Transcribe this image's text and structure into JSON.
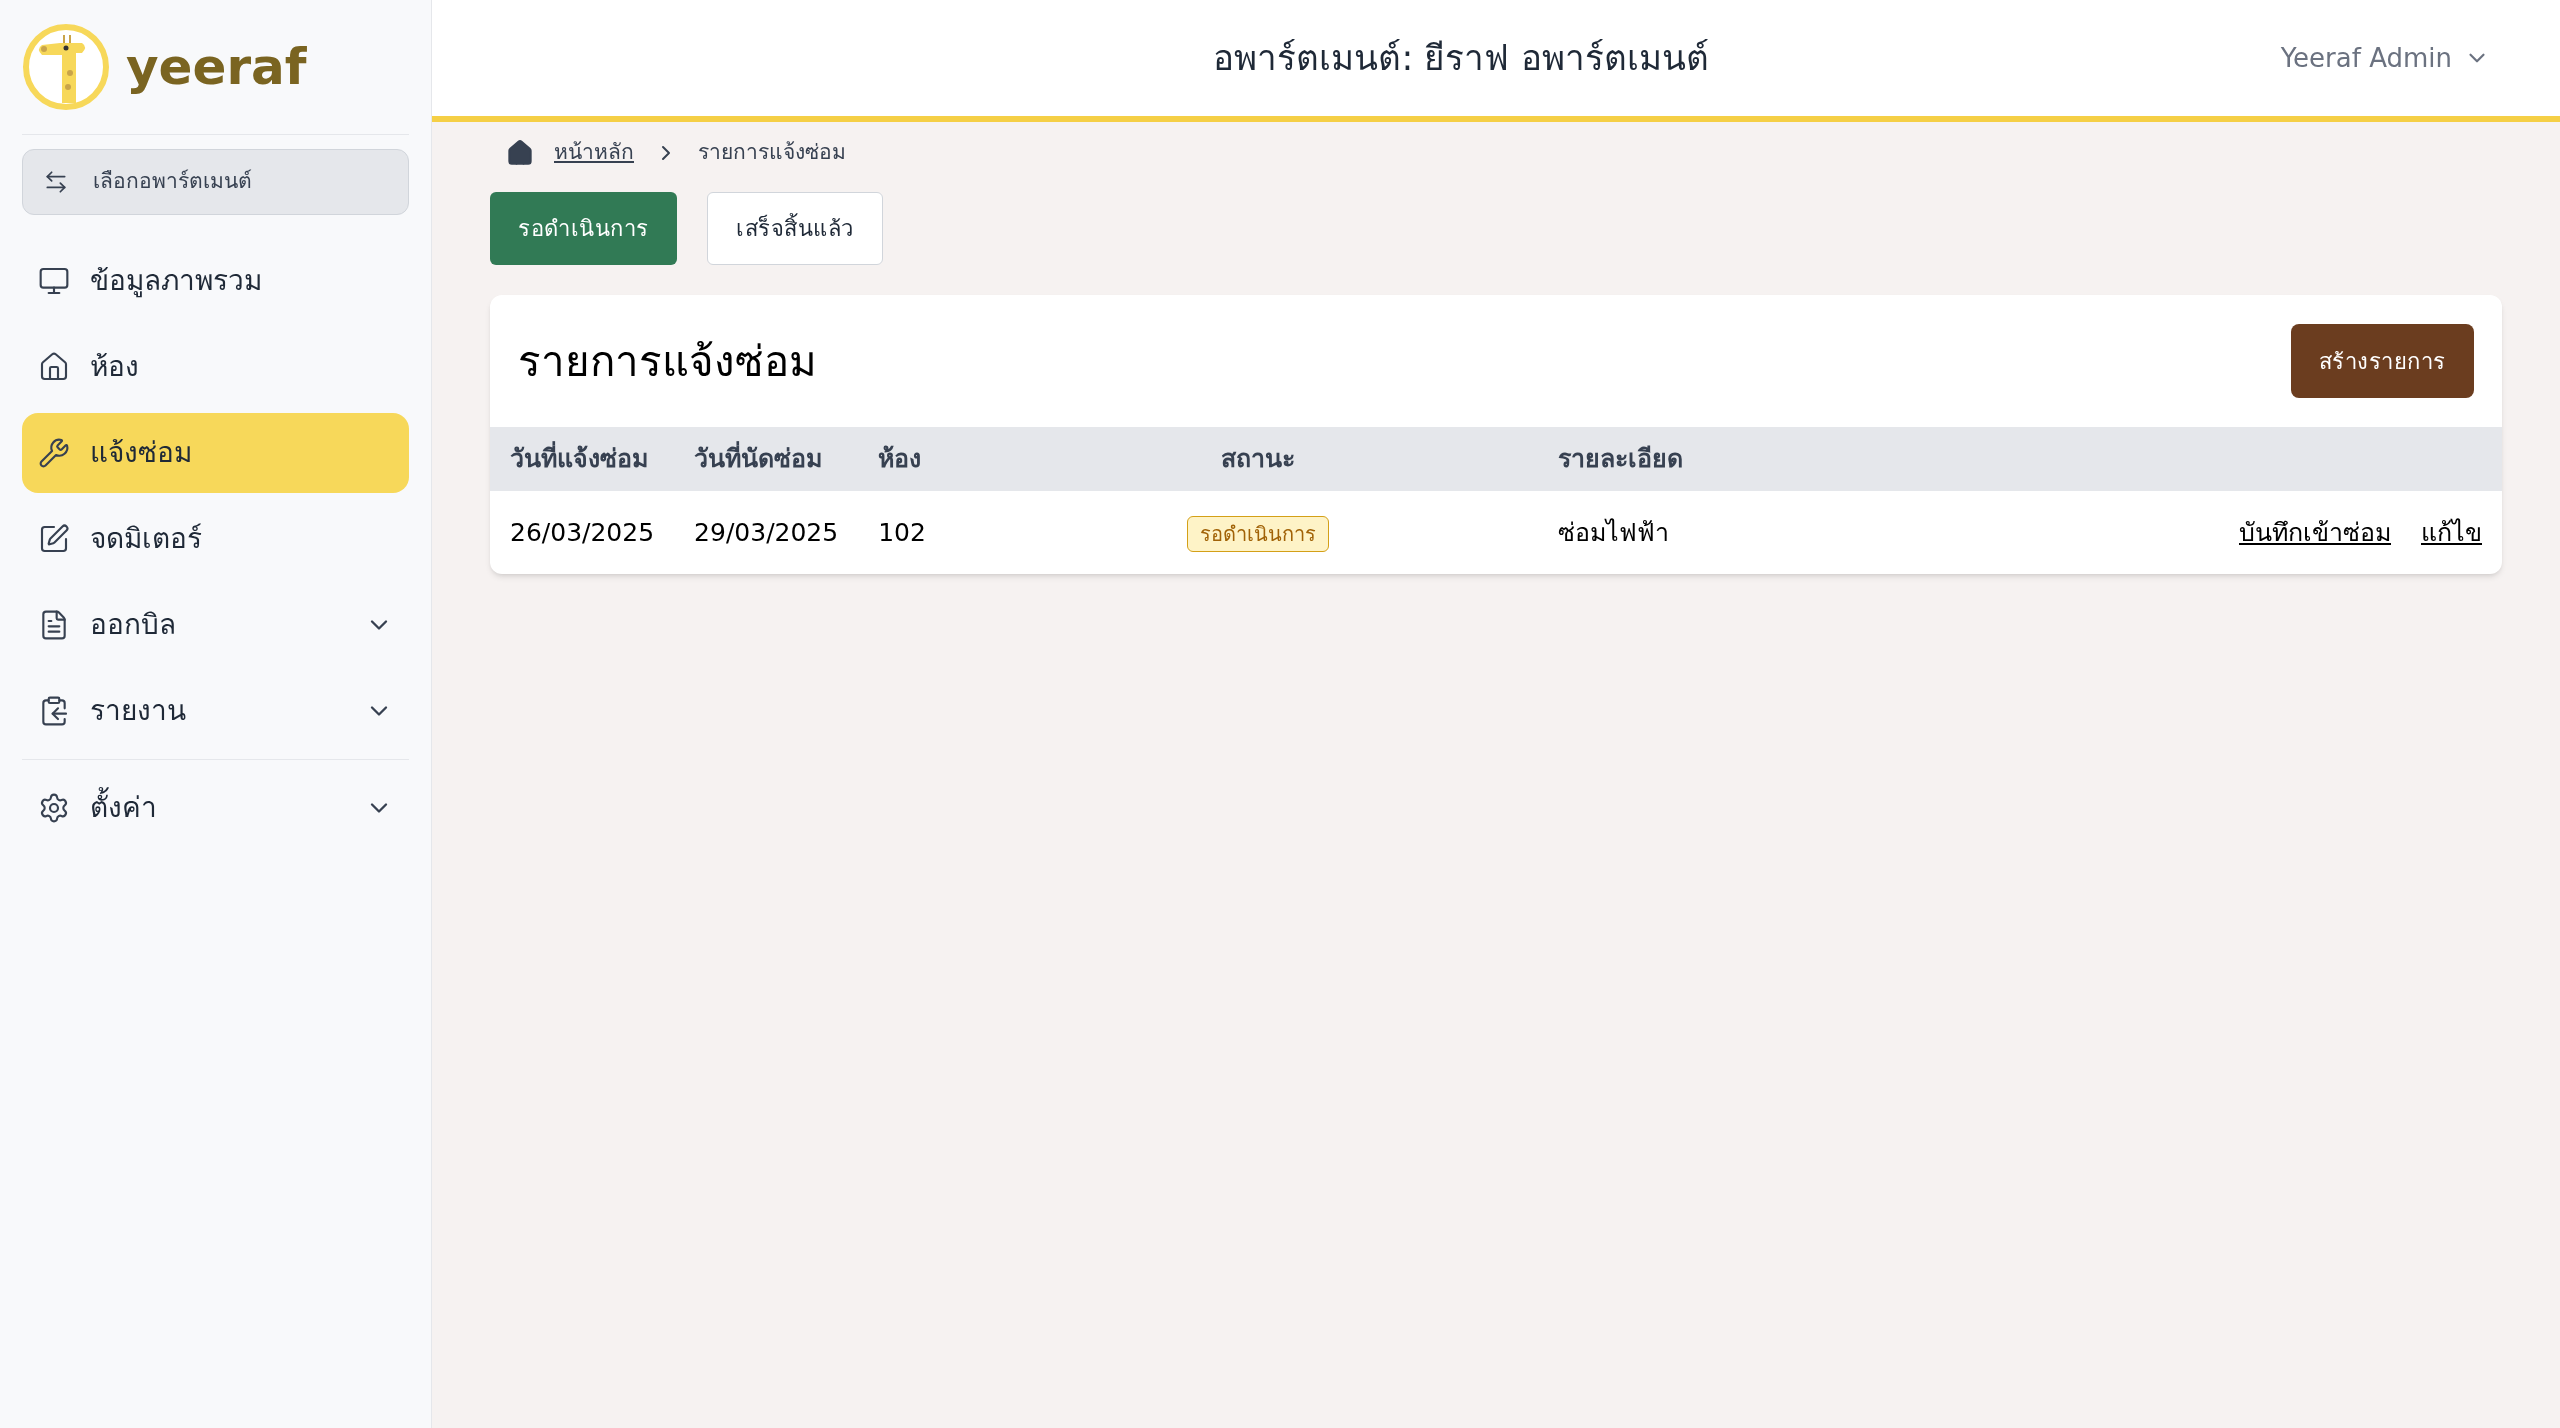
{
  "sidebar": {
    "logo": "yeeraf",
    "switch_button": "เลือกอพาร์ตเมนต์",
    "nav": [
      {
        "label": "ข้อมูลภาพรวม",
        "selected": false
      },
      {
        "label": "ห้อง",
        "selected": false
      },
      {
        "label": "แจ้งซ่อม",
        "selected": true
      },
      {
        "label": "จดมิเตอร์",
        "selected": false
      },
      {
        "label": "ออกบิล",
        "selected": false,
        "expanded": false
      },
      {
        "label": "รายงาน",
        "selected": false,
        "expanded": false
      }
    ],
    "nav_secondary": [
      {
        "label": "ตั้งค่า",
        "selected": false,
        "expanded": false
      }
    ]
  },
  "header": {
    "title": "อพาร์ตเมนต์: ยีราฟ อพาร์ตเมนต์",
    "user": "Yeeraf Admin"
  },
  "breadcrumb": [
    {
      "label": "หน้าหลัก",
      "link": true
    },
    {
      "label": "รายการแจ้งซ่อม",
      "link": false
    }
  ],
  "tabs": [
    {
      "label": "รอดำเนินการ",
      "selected": true
    },
    {
      "label": "เสร็จสิ้นแล้ว",
      "selected": false
    }
  ],
  "card": {
    "title": "รายการแจ้งซ่อม",
    "create_button": "สร้างรายการ",
    "columns": [
      "วันที่แจ้งซ่อม",
      "วันที่นัดซ่อม",
      "ห้อง",
      "สถานะ",
      "รายละเอียด"
    ],
    "rows": [
      {
        "reported": "26/03/2025",
        "scheduled": "29/03/2025",
        "room": "102",
        "status": {
          "label": "รอดำเนินการ",
          "kind": "pending"
        },
        "detail": "ซ่อมไฟฟ้า",
        "actions": [
          "บันทึกเข้าซ่อม",
          "แก้ไข"
        ]
      }
    ]
  }
}
